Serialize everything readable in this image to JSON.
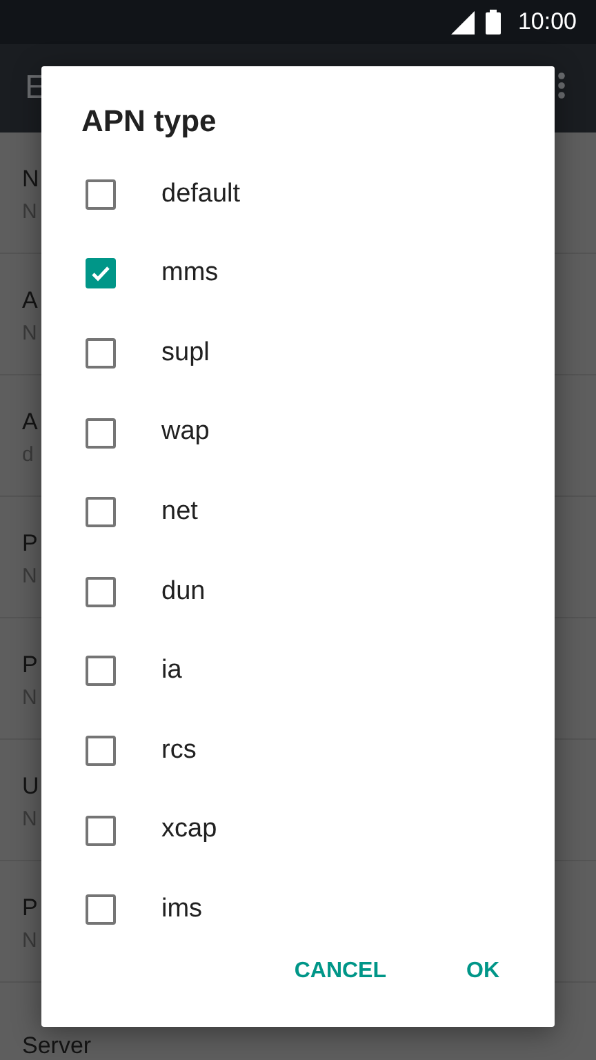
{
  "status_bar": {
    "time": "10:00"
  },
  "app_bar": {
    "title": "E"
  },
  "background_list": [
    {
      "title": "N",
      "subtitle": "N"
    },
    {
      "title": "A",
      "subtitle": "N"
    },
    {
      "title": "A",
      "subtitle": "d"
    },
    {
      "title": "P",
      "subtitle": "N"
    },
    {
      "title": "P",
      "subtitle": "N"
    },
    {
      "title": "U",
      "subtitle": "N"
    },
    {
      "title": "P",
      "subtitle": "N"
    },
    {
      "title": "Server"
    }
  ],
  "dialog": {
    "title": "APN type",
    "options": [
      {
        "label": "default",
        "checked": false
      },
      {
        "label": "mms",
        "checked": true
      },
      {
        "label": "supl",
        "checked": false
      },
      {
        "label": "wap",
        "checked": false
      },
      {
        "label": "net",
        "checked": false
      },
      {
        "label": "dun",
        "checked": false
      },
      {
        "label": "ia",
        "checked": false
      },
      {
        "label": "rcs",
        "checked": false
      },
      {
        "label": "xcap",
        "checked": false
      },
      {
        "label": "ims",
        "checked": false
      }
    ],
    "buttons": [
      "CANCEL",
      "OK"
    ]
  }
}
